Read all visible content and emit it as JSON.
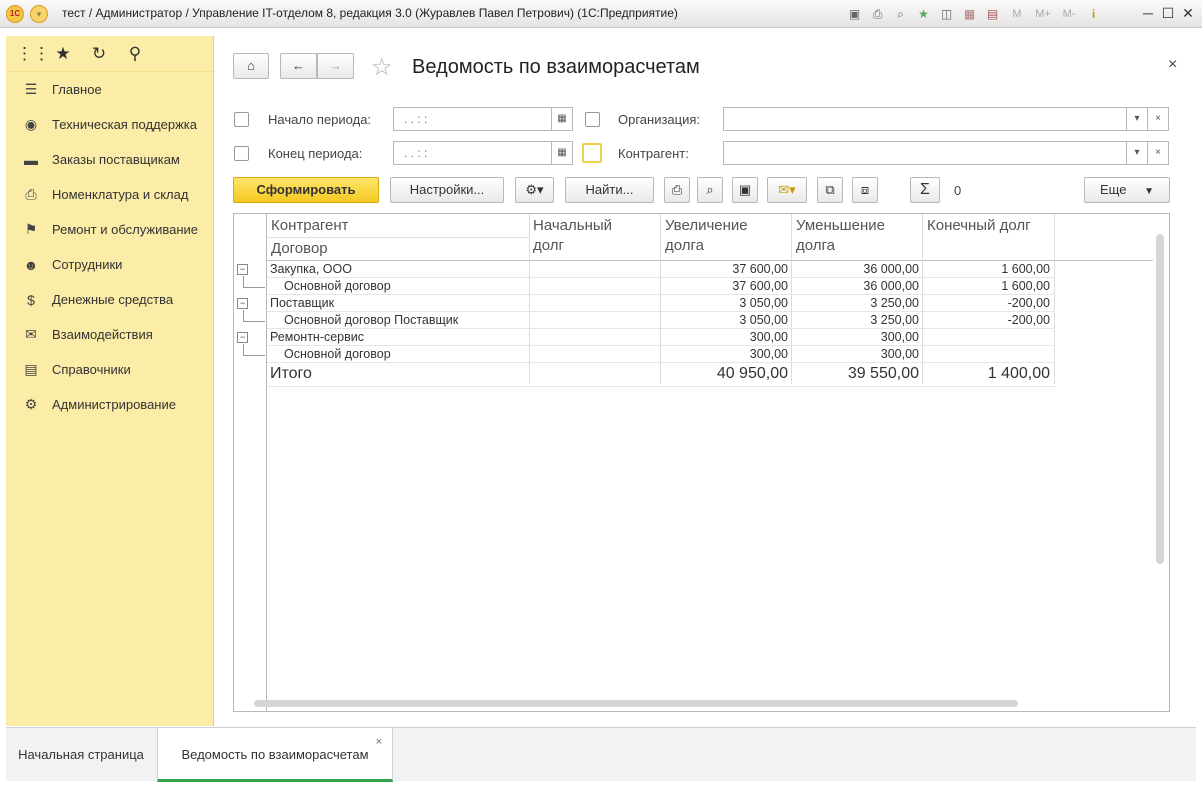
{
  "window": {
    "logo_text": "1С",
    "title": "тест / Администратор / Управление IT-отделом 8, редакция 3.0 (Журавлев Павел Петрович)  (1С:Предприятие)",
    "toolbar_icons": [
      "save-icon",
      "print-icon",
      "preview-icon",
      "favorites-icon",
      "history-icon",
      "calculator-icon",
      "calendar-icon"
    ],
    "memory_buttons": [
      "M",
      "M+",
      "M-"
    ],
    "info_label": "i"
  },
  "sidebar": {
    "items": [
      {
        "label": "Главное",
        "icon": "menu-lines-icon"
      },
      {
        "label": "Техническая поддержка",
        "icon": "support-icon"
      },
      {
        "label": "Заказы поставщикам",
        "icon": "truck-icon"
      },
      {
        "label": "Номенклатура и склад",
        "icon": "printer-icon"
      },
      {
        "label": "Ремонт и обслуживание",
        "icon": "flag-icon"
      },
      {
        "label": "Сотрудники",
        "icon": "people-icon"
      },
      {
        "label": "Денежные средства",
        "icon": "money-bag-icon"
      },
      {
        "label": "Взаимодействия",
        "icon": "envelope-icon"
      },
      {
        "label": "Справочники",
        "icon": "books-icon"
      },
      {
        "label": "Администрирование",
        "icon": "gear-icon"
      }
    ]
  },
  "form": {
    "title": "Ведомость по взаиморасчетам",
    "filters": {
      "period_start_label": "Начало периода:",
      "period_end_label": "Конец периода:",
      "period_start_value": ".  .      :  :",
      "period_end_value": ".  .      :  :",
      "organization_label": "Организация:",
      "counterparty_label": "Контрагент:",
      "organization_value": "",
      "counterparty_value": ""
    },
    "toolbar": {
      "generate": "Сформировать",
      "settings": "Настройки...",
      "find": "Найти...",
      "sum_value": "0",
      "more": "Еще"
    }
  },
  "report": {
    "headers": {
      "counterparty": "Контрагент",
      "contract": "Договор",
      "initial_debt_1": "Начальный",
      "initial_debt_2": "долг",
      "increase_1": "Увеличение",
      "increase_2": "долга",
      "decrease_1": "Уменьшение",
      "decrease_2": "долга",
      "final_debt": "Конечный долг"
    },
    "rows": [
      {
        "name": "Закупка, ООО",
        "level": 0,
        "initial": "",
        "increase": "37 600,00",
        "decrease": "36 000,00",
        "final": "1 600,00"
      },
      {
        "name": "Основной договор",
        "level": 1,
        "initial": "",
        "increase": "37 600,00",
        "decrease": "36 000,00",
        "final": "1 600,00"
      },
      {
        "name": "Поставщик",
        "level": 0,
        "initial": "",
        "increase": "3 050,00",
        "decrease": "3 250,00",
        "final": "-200,00"
      },
      {
        "name": "Основной договор Поставщик",
        "level": 1,
        "initial": "",
        "increase": "3 050,00",
        "decrease": "3 250,00",
        "final": "-200,00"
      },
      {
        "name": "Ремонтн-сервис",
        "level": 0,
        "initial": "",
        "increase": "300,00",
        "decrease": "300,00",
        "final": ""
      },
      {
        "name": "Основной договор",
        "level": 1,
        "initial": "",
        "increase": "300,00",
        "decrease": "300,00",
        "final": ""
      }
    ],
    "total": {
      "name": "Итого",
      "initial": "",
      "increase": "40 950,00",
      "decrease": "39 550,00",
      "final": "1 400,00"
    }
  },
  "tabs": [
    {
      "label": "Начальная страница"
    },
    {
      "label": "Ведомость по взаиморасчетам",
      "close": "×"
    }
  ]
}
